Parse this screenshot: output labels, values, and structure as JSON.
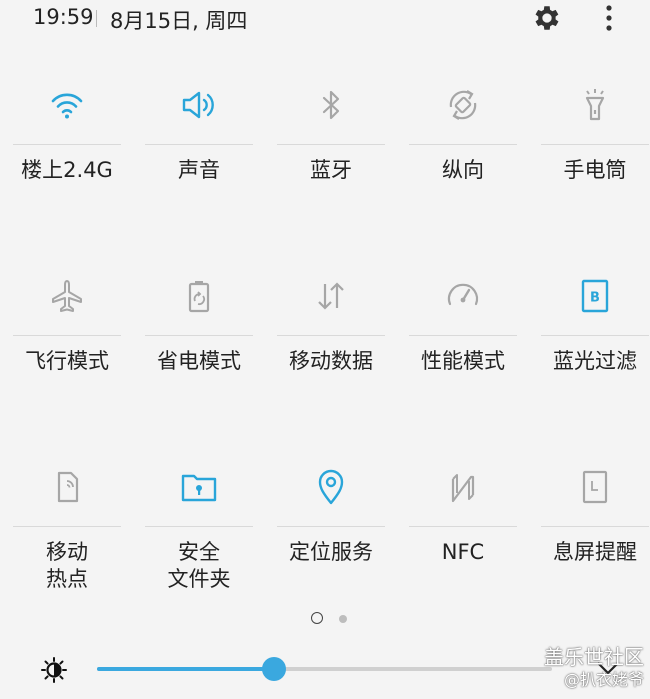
{
  "status_bar": {
    "time": "19:59",
    "date": "8月15日, 周四",
    "settings_icon": "gear-icon",
    "more_icon": "more-vertical-icon"
  },
  "colors": {
    "active": "#29a5d9",
    "inactive": "#a6a6a6",
    "label": "#222222",
    "background": "#f4f4f4"
  },
  "tiles": [
    {
      "label": "楼上2.4G",
      "icon": "wifi-icon",
      "active": true
    },
    {
      "label": "声音",
      "icon": "volume-icon",
      "active": true
    },
    {
      "label": "蓝牙",
      "icon": "bluetooth-icon",
      "active": false
    },
    {
      "label": "纵向",
      "icon": "rotation-icon",
      "active": false
    },
    {
      "label": "手电筒",
      "icon": "flashlight-icon",
      "active": false
    },
    {
      "label": "飞行模式",
      "icon": "airplane-icon",
      "active": false
    },
    {
      "label": "省电模式",
      "icon": "battery-saver-icon",
      "active": false
    },
    {
      "label": "移动数据",
      "icon": "mobile-data-icon",
      "active": false
    },
    {
      "label": "性能模式",
      "icon": "performance-icon",
      "active": false
    },
    {
      "label": "蓝光过滤",
      "icon": "blue-light-filter-icon",
      "active": true
    },
    {
      "label": "移动\n热点",
      "icon": "hotspot-icon",
      "active": false
    },
    {
      "label": "安全\n文件夹",
      "icon": "secure-folder-icon",
      "active": true
    },
    {
      "label": "定位服务",
      "icon": "location-icon",
      "active": true
    },
    {
      "label": "NFC",
      "icon": "nfc-icon",
      "active": false
    },
    {
      "label": "息屏提醒",
      "icon": "always-on-display-icon",
      "active": false
    }
  ],
  "pagination": {
    "current": 1,
    "total": 2
  },
  "brightness": {
    "icon": "brightness-icon",
    "level": 0.39,
    "expand_icon": "chevron-down-icon"
  },
  "watermark": {
    "line1": "盖乐世社区",
    "line2": "@扒衣姥爷"
  }
}
